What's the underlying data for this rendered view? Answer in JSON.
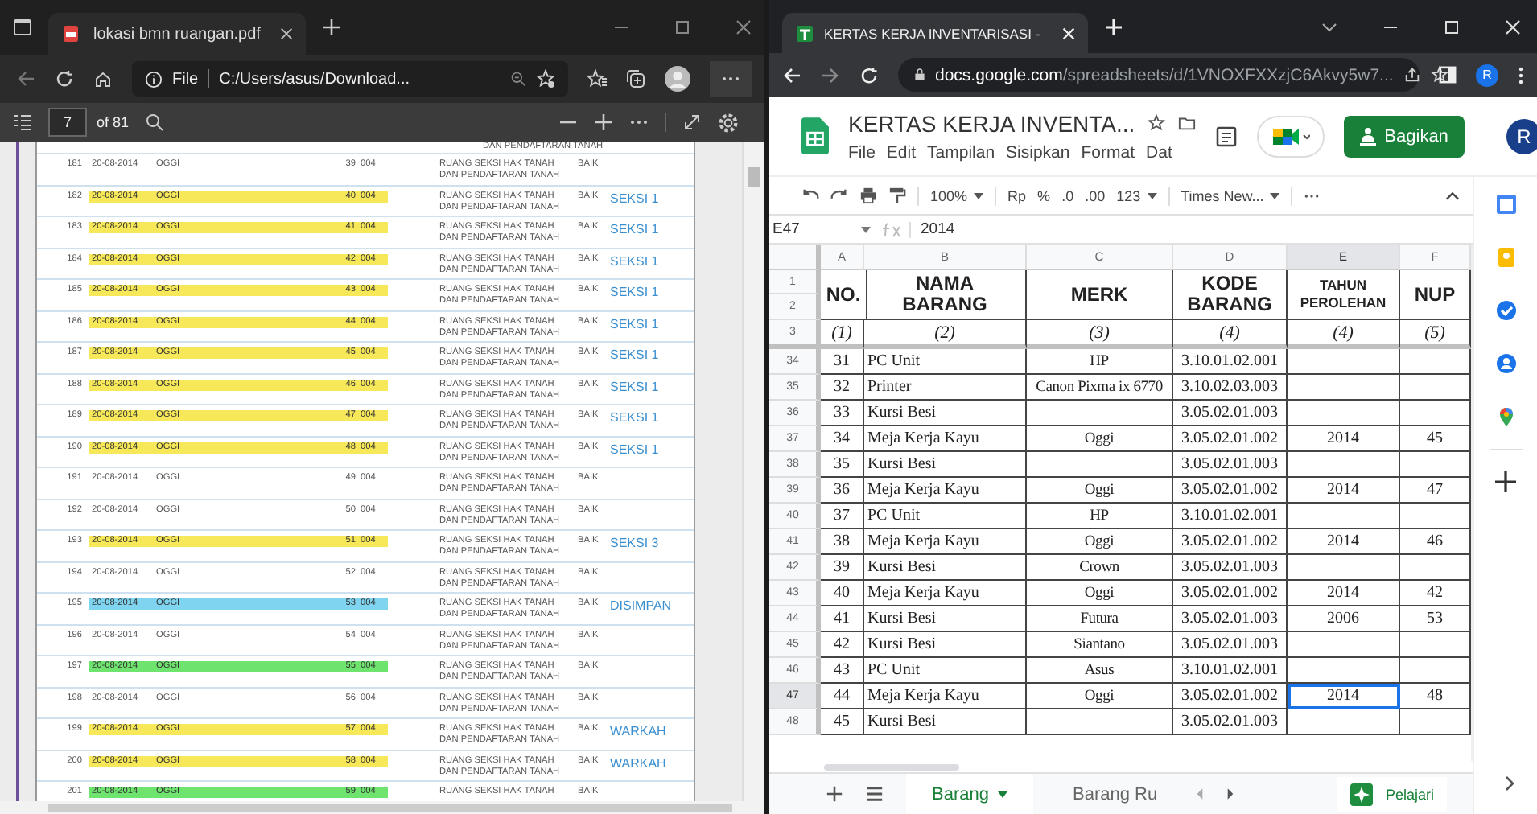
{
  "pdf_window": {
    "tab_title": "lokasi bmn ruangan.pdf",
    "address": {
      "scheme": "File",
      "path": "C:/Users/asus/Download..."
    },
    "toolbar": {
      "page": "7",
      "page_count": "of 81"
    },
    "top_fragment": "DAN PENDAFTARAN TANAH",
    "rows": [
      {
        "no": "181",
        "date": "20-08-2014",
        "name": "OGGI",
        "num": "39",
        "code": "004",
        "room": "RUANG SEKSI HAK TANAH\nDAN PENDAFTARAN TANAH",
        "condition": "BAIK"
      },
      {
        "no": "182",
        "date": "20-08-2014",
        "name": "OGGI",
        "num": "40",
        "code": "004",
        "room": "RUANG SEKSI HAK TANAH\nDAN PENDAFTARAN TANAH",
        "condition": "BAIK",
        "note": "SEKSI 1",
        "color": "#f7e859"
      },
      {
        "no": "183",
        "date": "20-08-2014",
        "name": "OGGI",
        "num": "41",
        "code": "004",
        "room": "RUANG SEKSI HAK TANAH\nDAN PENDAFTARAN TANAH",
        "condition": "BAIK",
        "note": "SEKSI 1",
        "color": "#f7e859"
      },
      {
        "no": "184",
        "date": "20-08-2014",
        "name": "OGGI",
        "num": "42",
        "code": "004",
        "room": "RUANG SEKSI HAK TANAH\nDAN PENDAFTARAN TANAH",
        "condition": "BAIK",
        "note": "SEKSI 1",
        "color": "#f7e859"
      },
      {
        "no": "185",
        "date": "20-08-2014",
        "name": "OGGI",
        "num": "43",
        "code": "004",
        "room": "RUANG SEKSI HAK TANAH\nDAN PENDAFTARAN TANAH",
        "condition": "BAIK",
        "note": "SEKSI 1",
        "color": "#f7e859"
      },
      {
        "no": "186",
        "date": "20-08-2014",
        "name": "OGGI",
        "num": "44",
        "code": "004",
        "room": "RUANG SEKSI HAK TANAH\nDAN PENDAFTARAN TANAH",
        "condition": "BAIK",
        "note": "SEKSI 1",
        "color": "#f7e859"
      },
      {
        "no": "187",
        "date": "20-08-2014",
        "name": "OGGI",
        "num": "45",
        "code": "004",
        "room": "RUANG SEKSI HAK TANAH\nDAN PENDAFTARAN TANAH",
        "condition": "BAIK",
        "note": "SEKSI 1",
        "color": "#f7e859"
      },
      {
        "no": "188",
        "date": "20-08-2014",
        "name": "OGGI",
        "num": "46",
        "code": "004",
        "room": "RUANG SEKSI HAK TANAH\nDAN PENDAFTARAN TANAH",
        "condition": "BAIK",
        "note": "SEKSI 1",
        "color": "#f7e859"
      },
      {
        "no": "189",
        "date": "20-08-2014",
        "name": "OGGI",
        "num": "47",
        "code": "004",
        "room": "RUANG SEKSI HAK TANAH\nDAN PENDAFTARAN TANAH",
        "condition": "BAIK",
        "note": "SEKSI 1",
        "color": "#f7e859"
      },
      {
        "no": "190",
        "date": "20-08-2014",
        "name": "OGGI",
        "num": "48",
        "code": "004",
        "room": "RUANG SEKSI HAK TANAH\nDAN PENDAFTARAN TANAH",
        "condition": "BAIK",
        "note": "SEKSI 1",
        "color": "#f7e859"
      },
      {
        "no": "191",
        "date": "20-08-2014",
        "name": "OGGI",
        "num": "49",
        "code": "004",
        "room": "RUANG SEKSI HAK TANAH\nDAN PENDAFTARAN TANAH",
        "condition": "BAIK"
      },
      {
        "no": "192",
        "date": "20-08-2014",
        "name": "OGGI",
        "num": "50",
        "code": "004",
        "room": "RUANG SEKSI HAK TANAH\nDAN PENDAFTARAN TANAH",
        "condition": "BAIK"
      },
      {
        "no": "193",
        "date": "20-08-2014",
        "name": "OGGI",
        "num": "51",
        "code": "004",
        "room": "RUANG SEKSI HAK TANAH\nDAN PENDAFTARAN TANAH",
        "condition": "BAIK",
        "note": "SEKSI 3",
        "color": "#f7e859"
      },
      {
        "no": "194",
        "date": "20-08-2014",
        "name": "OGGI",
        "num": "52",
        "code": "004",
        "room": "RUANG SEKSI HAK TANAH\nDAN PENDAFTARAN TANAH",
        "condition": "BAIK"
      },
      {
        "no": "195",
        "date": "20-08-2014",
        "name": "OGGI",
        "num": "53",
        "code": "004",
        "room": "RUANG SEKSI HAK TANAH\nDAN PENDAFTARAN TANAH",
        "condition": "BAIK",
        "note": "DISIMPAN",
        "color": "#7fd4f0"
      },
      {
        "no": "196",
        "date": "20-08-2014",
        "name": "OGGI",
        "num": "54",
        "code": "004",
        "room": "RUANG SEKSI HAK TANAH\nDAN PENDAFTARAN TANAH",
        "condition": "BAIK"
      },
      {
        "no": "197",
        "date": "20-08-2014",
        "name": "OGGI",
        "num": "55",
        "code": "004",
        "room": "RUANG SEKSI HAK TANAH\nDAN PENDAFTARAN TANAH",
        "condition": "BAIK",
        "color": "#6ee36e"
      },
      {
        "no": "198",
        "date": "20-08-2014",
        "name": "OGGI",
        "num": "56",
        "code": "004",
        "room": "RUANG SEKSI HAK TANAH\nDAN PENDAFTARAN TANAH",
        "condition": "BAIK"
      },
      {
        "no": "199",
        "date": "20-08-2014",
        "name": "OGGI",
        "num": "57",
        "code": "004",
        "room": "RUANG SEKSI HAK TANAH\nDAN PENDAFTARAN TANAH",
        "condition": "BAIK",
        "note": "WARKAH",
        "color": "#f7e859"
      },
      {
        "no": "200",
        "date": "20-08-2014",
        "name": "OGGI",
        "num": "58",
        "code": "004",
        "room": "RUANG SEKSI HAK TANAH\nDAN PENDAFTARAN TANAH",
        "condition": "BAIK",
        "note": "WARKAH",
        "color": "#f7e859"
      },
      {
        "no": "201",
        "date": "20-08-2014",
        "name": "OGGI",
        "num": "59",
        "code": "004",
        "room": "RUANG SEKSI HAK TANAH",
        "condition": "BAIK",
        "color": "#6ee36e"
      }
    ]
  },
  "sheets_window": {
    "tab_title": "KERTAS KERJA INVENTARISASI - ",
    "url": "**docs.google.com**/spreadsheets/d/1VNOXFXXzjC6Akvy5w7...",
    "profile": "R",
    "doc_title": "KERTAS KERJA INVENTA...",
    "menu": [
      "File",
      "Edit",
      "Tampilan",
      "Sisipkan",
      "Format",
      "Dat"
    ],
    "share_button": "Bagikan",
    "avatar": "R",
    "toolbar": {
      "zoom": "100%",
      "currency": "Rp",
      "percent": "%",
      "decrease_decimal": ".0",
      "increase_decimal": ".00",
      "number_format": "123",
      "font": "Times New..."
    },
    "name_box": "E47",
    "formula": "2014",
    "columns": [
      {
        "label": "A",
        "selected": false
      },
      {
        "label": "B",
        "selected": false
      },
      {
        "label": "C",
        "selected": false
      },
      {
        "label": "D",
        "selected": false
      },
      {
        "label": "E",
        "selected": true
      },
      {
        "label": "F",
        "selected": false
      }
    ],
    "header_rows": [
      "1",
      "2",
      "3"
    ],
    "headers": [
      "NO.",
      "NAMA BARANG",
      "MERK",
      "KODE BARANG",
      "TAHUN PEROLEHAN",
      "NUP"
    ],
    "header_numbers": [
      "(1)",
      "(2)",
      "(3)",
      "(4)",
      "(4)",
      "(5)"
    ],
    "rows": [
      {
        "row": "34",
        "no": "31",
        "name": "PC Unit",
        "brand": "HP",
        "code": "3.10.01.02.001",
        "selected": false
      },
      {
        "row": "35",
        "no": "32",
        "name": "Printer",
        "brand": "Canon Pixma ix 6770",
        "code": "3.10.02.03.003",
        "selected": false
      },
      {
        "row": "36",
        "no": "33",
        "name": "Kursi Besi",
        "code": "3.05.02.01.003",
        "selected": false
      },
      {
        "row": "37",
        "no": "34",
        "name": "Meja Kerja Kayu",
        "brand": "Oggi",
        "code": "3.05.02.01.002",
        "year": "2014",
        "nup": "45",
        "selected": false
      },
      {
        "row": "38",
        "no": "35",
        "name": "Kursi Besi",
        "code": "3.05.02.01.003",
        "selected": false
      },
      {
        "row": "39",
        "no": "36",
        "name": "Meja Kerja Kayu",
        "brand": "Oggi",
        "code": "3.05.02.01.002",
        "year": "2014",
        "nup": "47",
        "selected": false
      },
      {
        "row": "40",
        "no": "37",
        "name": "PC Unit",
        "brand": "HP",
        "code": "3.10.01.02.001",
        "selected": false
      },
      {
        "row": "41",
        "no": "38",
        "name": "Meja Kerja Kayu",
        "brand": "Oggi",
        "code": "3.05.02.01.002",
        "year": "2014",
        "nup": "46",
        "selected": false
      },
      {
        "row": "42",
        "no": "39",
        "name": "Kursi Besi",
        "brand": "Crown",
        "code": "3.05.02.01.003",
        "selected": false
      },
      {
        "row": "43",
        "no": "40",
        "name": "Meja Kerja Kayu",
        "brand": "Oggi",
        "code": "3.05.02.01.002",
        "year": "2014",
        "nup": "42",
        "selected": false
      },
      {
        "row": "44",
        "no": "41",
        "name": "Kursi Besi",
        "brand": "Futura",
        "code": "3.05.02.01.003",
        "year": "2006",
        "nup": "53",
        "selected": false
      },
      {
        "row": "45",
        "no": "42",
        "name": "Kursi Besi",
        "brand": "Siantano",
        "code": "3.05.02.01.003",
        "selected": false
      },
      {
        "row": "46",
        "no": "43",
        "name": "PC Unit",
        "brand": "Asus",
        "code": "3.10.01.02.001",
        "selected": false
      },
      {
        "row": "47",
        "no": "44",
        "name": "Meja Kerja Kayu",
        "brand": "Oggi",
        "code": "3.05.02.01.002",
        "year": "2014",
        "nup": "48",
        "selected": true
      },
      {
        "row": "48",
        "no": "45",
        "name": "Kursi Besi",
        "code": "3.05.02.01.003",
        "selected": false
      }
    ],
    "sheet_tabs": [
      {
        "label": "Barang",
        "selected": true
      },
      {
        "label": "Barang Ru",
        "selected": false
      }
    ],
    "explore": "Pelajari"
  }
}
